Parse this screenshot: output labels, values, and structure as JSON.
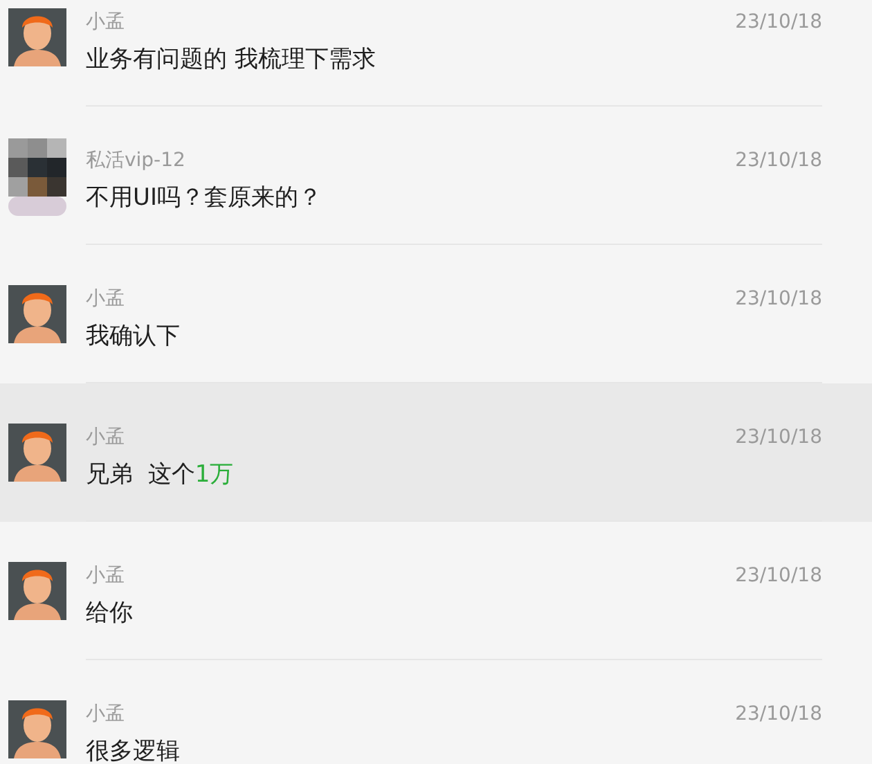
{
  "messages": [
    {
      "sender": "小孟",
      "time": "23/10/18",
      "kind": "cartoon",
      "selected": false,
      "segments": [
        {
          "text": "业务有问题的 我梳理下需求"
        }
      ]
    },
    {
      "sender": "私活vip-12",
      "time": "23/10/18",
      "kind": "pixelated",
      "selected": false,
      "segments": [
        {
          "text": "不用UI吗？套原来的？"
        }
      ]
    },
    {
      "sender": "小孟",
      "time": "23/10/18",
      "kind": "cartoon",
      "selected": false,
      "segments": [
        {
          "text": "我确认下"
        }
      ]
    },
    {
      "sender": "小孟",
      "time": "23/10/18",
      "kind": "cartoon",
      "selected": true,
      "segments": [
        {
          "text": "兄弟  这个"
        },
        {
          "text": "1万",
          "color": "#2aae39"
        }
      ]
    },
    {
      "sender": "小孟",
      "time": "23/10/18",
      "kind": "cartoon",
      "selected": false,
      "segments": [
        {
          "text": "给你"
        }
      ]
    },
    {
      "sender": "小孟",
      "time": "23/10/18",
      "kind": "cartoon",
      "selected": false,
      "segments": [
        {
          "text": "很多逻辑"
        }
      ]
    }
  ]
}
